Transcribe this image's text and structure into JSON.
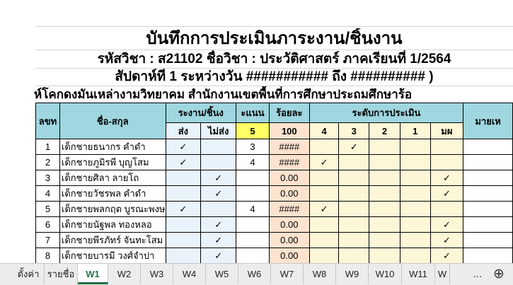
{
  "header": {
    "title": "บันทึกการประเมินภาระงาน/ชิ้นงาน",
    "line2": "รหัสวิชา : ส21102  ชื่อวิชา : ประวัติศาสตร์  ภาคเรียนที่ 1/2564",
    "line3": "สัปดาห์ที่ 1   ระหว่างวัน ########### ถึง ########## )",
    "line4": "ห์โคกดงมันเหล่างามวิทยาคม  สำนักงานเขตพื้นที่การศึกษาประถมศึกษาร้อ"
  },
  "columns": {
    "no": "ลขท",
    "name": "ชื่อ-สกุล",
    "submit": "ระงาน/ชิ้นง",
    "score": "ะแนน",
    "percent": "ร้อยละ",
    "level": "ระดับการประเมิน",
    "note": "มายเห",
    "sent": "ส่ง",
    "notsent": "ไม่ส่ง",
    "max": "5",
    "hundred": "100",
    "l4": "4",
    "l3": "3",
    "l2": "2",
    "l1": "1",
    "lf": "มผ"
  },
  "check": "✓",
  "rows": [
    {
      "no": "1",
      "name": "เด็กชายธนากร  คำดำ",
      "sent": true,
      "notsent": false,
      "score": "3",
      "pct": "####",
      "level": "3"
    },
    {
      "no": "2",
      "name": "เด็กชายภูมิรพี บุญโสม",
      "sent": true,
      "notsent": false,
      "score": "4",
      "pct": "####",
      "level": "4"
    },
    {
      "no": "3",
      "name": "เด็กชายศิลา  ลายโถ",
      "sent": false,
      "notsent": true,
      "score": "",
      "pct": "0.00",
      "level": "มผ"
    },
    {
      "no": "4",
      "name": "เด็กชายวัชรพล  คำดำ",
      "sent": false,
      "notsent": true,
      "score": "",
      "pct": "0.00",
      "level": "มผ"
    },
    {
      "no": "5",
      "name": "เด็กชายพลกฤต  บูรณะพงษ",
      "sent": true,
      "notsent": false,
      "score": "4",
      "pct": "####",
      "level": "4"
    },
    {
      "no": "6",
      "name": "เด็กชายนัฐพล  ทองหลอ",
      "sent": false,
      "notsent": true,
      "score": "",
      "pct": "0.00",
      "level": "มผ"
    },
    {
      "no": "7",
      "name": "เด็กชายพีรภัทร์ จันทะโสม",
      "sent": false,
      "notsent": true,
      "score": "",
      "pct": "0.00",
      "level": "มผ"
    },
    {
      "no": "8",
      "name": "เด็กชายบารมี วงศ์จำปา",
      "sent": false,
      "notsent": true,
      "score": "",
      "pct": "0.00",
      "level": "มผ"
    },
    {
      "no": "9",
      "name": "เด็กชายชนะชัย นามชารี",
      "sent": false,
      "notsent": true,
      "score": "",
      "pct": "0.00",
      "level": "มผ"
    },
    {
      "no": "10",
      "name": "เด็กชายภูวนัย  หอมเลิศ",
      "sent": false,
      "notsent": true,
      "score": "",
      "pct": "0.00",
      "level": "มผ"
    }
  ],
  "tabs": {
    "nav_prev": "◀",
    "nav_next": "▶",
    "items": [
      "ตั้งค่า",
      "รายชื่อ",
      "W1",
      "W2",
      "W3",
      "W4",
      "W5",
      "W6",
      "W7",
      "W8",
      "W9",
      "W10",
      "W11",
      "W"
    ],
    "active": "W1",
    "more": "...",
    "add": "⊕"
  },
  "colors": {
    "header_bg": "#9fd6df",
    "yellow": "#ffff66",
    "active_tab": "#217346"
  }
}
